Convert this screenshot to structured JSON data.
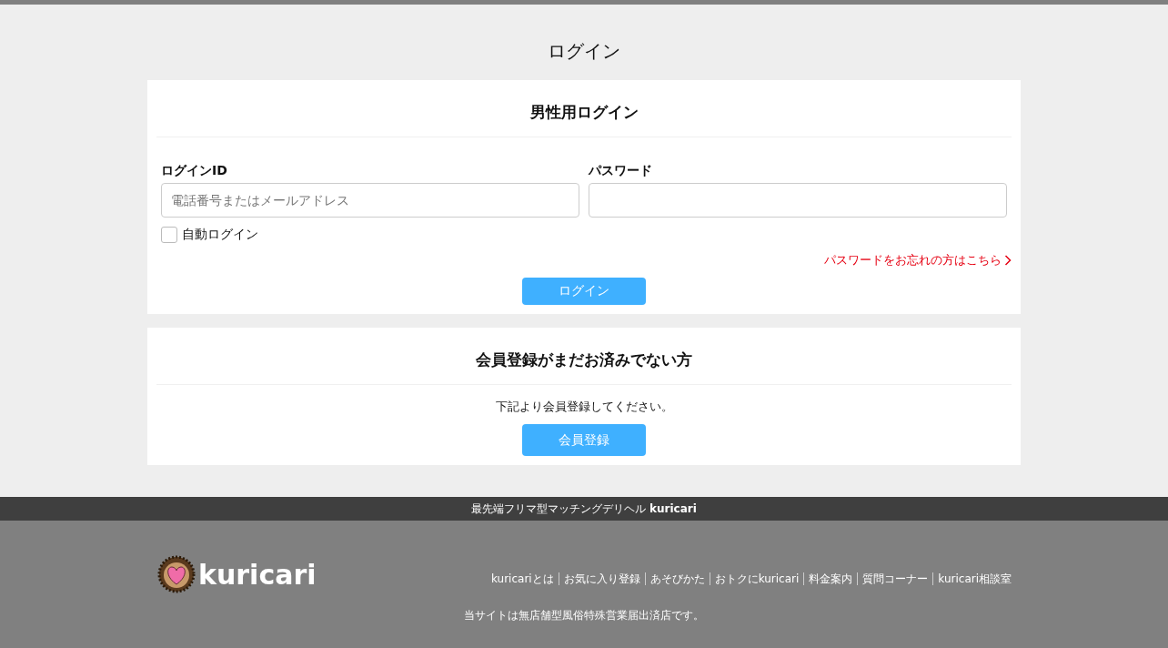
{
  "page_title": "ログイン",
  "login_card": {
    "title": "男性用ログイン",
    "id_field": {
      "label": "ログインID",
      "placeholder": "電話番号またはメールアドレス"
    },
    "password_field": {
      "label": "パスワード"
    },
    "auto_login": {
      "label": "自動ログイン",
      "checked": false
    },
    "forgot_link": "パスワードをお忘れの方はこちら",
    "submit_button": "ログイン"
  },
  "register_card": {
    "title": "会員登録がまだお済みでない方",
    "text": "下記より会員登録してください。",
    "button": "会員登録"
  },
  "tagline": "最先端フリマ型マッチングデリヘル **kuricari**",
  "footer": {
    "logo_text": "kuricari",
    "links": [
      "kuricariとは",
      "お気に入り登録",
      "あそびかた",
      "おトクにkuricari",
      "料金案内",
      "質問コーナー",
      "kuricari相談室"
    ],
    "notice": "当サイトは無店舗型風俗特殊営業届出済店です。"
  }
}
